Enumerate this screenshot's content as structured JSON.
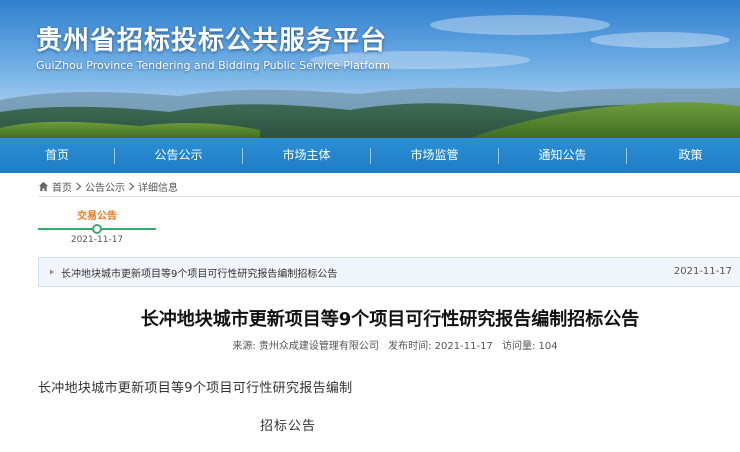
{
  "header": {
    "site_title": "贵州省招标投标公共服务平台",
    "site_subtitle": "GuiZhou Province Tendering and Bidding Public Service Platform"
  },
  "nav": {
    "items": [
      {
        "label": "首页"
      },
      {
        "label": "公告公示"
      },
      {
        "label": "市场主体"
      },
      {
        "label": "市场监管"
      },
      {
        "label": "通知公告"
      },
      {
        "label": "政策"
      }
    ]
  },
  "breadcrumb": {
    "home": "首页",
    "section": "公告公示",
    "current": "详细信息"
  },
  "timeline": {
    "stage_label": "交易公告",
    "stage_date": "2021-11-17"
  },
  "notice": {
    "title": "长冲地块城市更新项目等9个项目可行性研究报告编制招标公告",
    "date": "2021-11-17"
  },
  "article": {
    "title": "长冲地块城市更新项目等9个项目可行性研究报告编制招标公告",
    "source": "来源: 贵州众成建设管理有限公司",
    "publish_time": "发布时间: 2021-11-17",
    "views": "访问量: 104",
    "body_line1": "长冲地块城市更新项目等9个项目可行性研究报告编制",
    "body_line2": "招标公告"
  },
  "colors": {
    "nav_blue": "#2485cc",
    "timeline_green": "#39a86e",
    "stage_orange": "#ef7a1a"
  }
}
